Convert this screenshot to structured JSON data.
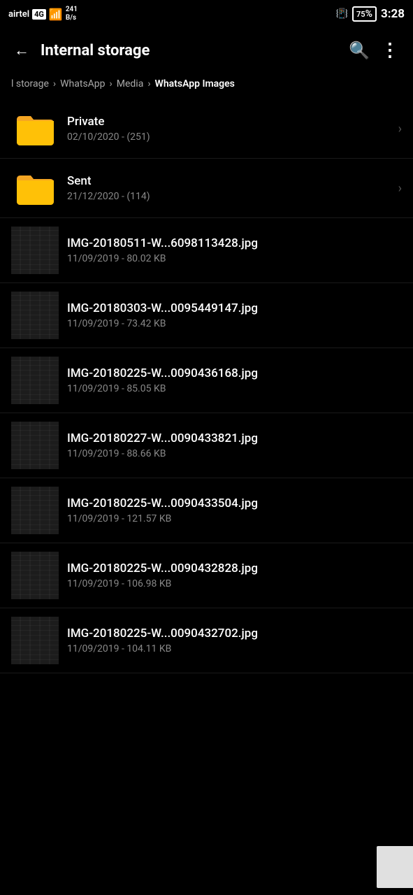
{
  "statusBar": {
    "carrier": "airtel",
    "networkType": "4G",
    "dataSpeed": "241\nB/s",
    "batteryPercent": "75",
    "time": "3:28"
  },
  "topBar": {
    "title": "Internal storage",
    "backIcon": "←",
    "searchIcon": "⌕",
    "moreIcon": "⋮"
  },
  "breadcrumb": {
    "items": [
      {
        "label": "l storage",
        "active": false
      },
      {
        "label": "WhatsApp",
        "active": false
      },
      {
        "label": "Media",
        "active": false
      },
      {
        "label": "WhatsApp Images",
        "active": true
      }
    ],
    "separator": "›"
  },
  "folders": [
    {
      "name": "Private",
      "meta": "02/10/2020 - (251)",
      "hasChevron": true
    },
    {
      "name": "Sent",
      "meta": "21/12/2020 - (114)",
      "hasChevron": true
    }
  ],
  "files": [
    {
      "name": "IMG-20180511-W...6098113428.jpg",
      "meta": "11/09/2019 - 80.02 KB"
    },
    {
      "name": "IMG-20180303-W...0095449147.jpg",
      "meta": "11/09/2019 - 73.42 KB"
    },
    {
      "name": "IMG-20180225-W...0090436168.jpg",
      "meta": "11/09/2019 - 85.05 KB"
    },
    {
      "name": "IMG-20180227-W...0090433821.jpg",
      "meta": "11/09/2019 - 88.66 KB"
    },
    {
      "name": "IMG-20180225-W...0090433504.jpg",
      "meta": "11/09/2019 - 121.57 KB"
    },
    {
      "name": "IMG-20180225-W...0090432828.jpg",
      "meta": "11/09/2019 - 106.98 KB"
    },
    {
      "name": "IMG-20180225-W...0090432702.jpg",
      "meta": "11/09/2019 - 104.11 KB"
    }
  ]
}
